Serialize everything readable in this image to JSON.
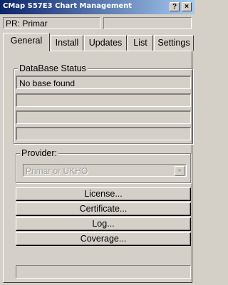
{
  "window": {
    "title": "CMap S57E3 Chart Management"
  },
  "title_buttons": {
    "help": "?",
    "close": "×"
  },
  "pr_label": "PR: Primar",
  "tabs": [
    "General",
    "Install",
    "Updates",
    "List",
    "Settings"
  ],
  "active_tab": "General",
  "database_status": {
    "legend": "DataBase Status",
    "rows": [
      "No base found",
      "",
      "",
      ""
    ]
  },
  "provider": {
    "legend": "Provider:",
    "selected": "Primar or UKHO"
  },
  "buttons": {
    "license": "License...",
    "certificate": "Certificate...",
    "log": "Log...",
    "coverage": "Coverage..."
  },
  "status_bar": ""
}
